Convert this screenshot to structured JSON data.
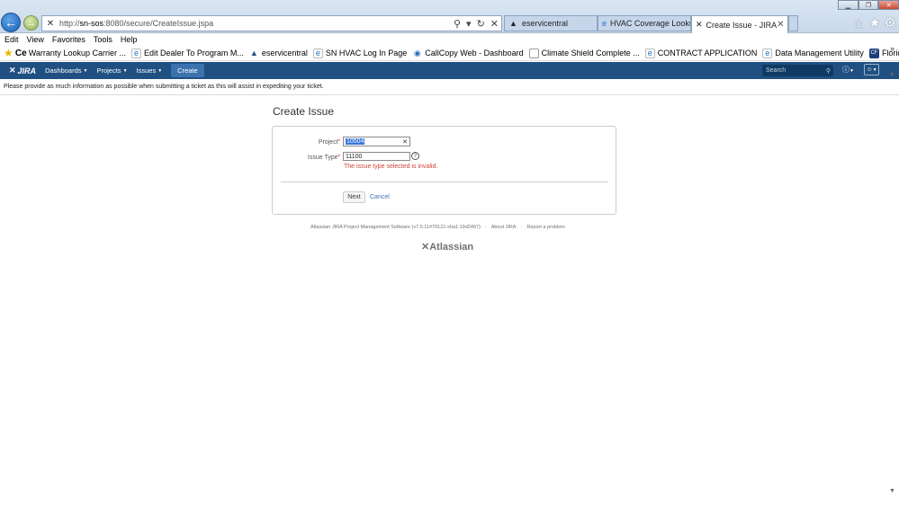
{
  "browser": {
    "url_prefix": "http://",
    "url_host": "sn-sos",
    "url_rest": ":8080/secure/CreateIssue.jspa",
    "tabs": [
      {
        "label": "eservicentral",
        "icon": "atlassian-icon",
        "active": false
      },
      {
        "label": "HVAC Coverage Lookup",
        "icon": "ie-icon",
        "active": false
      },
      {
        "label": "Create Issue - JIRA",
        "icon": "jira-icon",
        "active": true
      }
    ]
  },
  "menu": [
    "Edit",
    "View",
    "Favorites",
    "Tools",
    "Help"
  ],
  "favorites": [
    {
      "label": "Warranty Lookup  Carrier ...",
      "icon": "ce-icon"
    },
    {
      "label": "Edit Dealer To Program M...",
      "icon": "ie-icon"
    },
    {
      "label": "eservicentral",
      "icon": "atlassian-icon"
    },
    {
      "label": "SN HVAC Log In Page",
      "icon": "ie-icon"
    },
    {
      "label": "CallCopy Web - Dashboard",
      "icon": "globe-icon"
    },
    {
      "label": "Climate Shield Complete ...",
      "icon": "page-icon"
    },
    {
      "label": "CONTRACT APPLICATION",
      "icon": "ie-icon"
    },
    {
      "label": "Data Management Utility",
      "icon": "ie-icon"
    },
    {
      "label": "Florida CFO",
      "icon": "cfo-icon"
    }
  ],
  "jira": {
    "logo": "JIRA",
    "nav": [
      "Dashboards",
      "Projects",
      "Issues"
    ],
    "create_label": "Create",
    "search_placeholder": "Search"
  },
  "announcement": "Please provide as much information as possible when submitting a ticket as this will assist in expediting your ticket.",
  "form": {
    "title": "Create Issue",
    "project_label": "Project",
    "project_value": "10504",
    "issuetype_label": "Issue Type",
    "issuetype_value": "11100",
    "error": "The issue type selected is invalid.",
    "next_label": "Next",
    "cancel_label": "Cancel"
  },
  "footer": {
    "software": "Atlassian JIRA Project Management Software (v7.0.11#70121-sha1:19d2497)",
    "about": "About JIRA",
    "report": "Report a problem",
    "logo_text": "Atlassian"
  },
  "colors": {
    "jira_header": "#205081",
    "create_button": "#3b73af",
    "error": "#d04437",
    "link": "#3b73af"
  }
}
